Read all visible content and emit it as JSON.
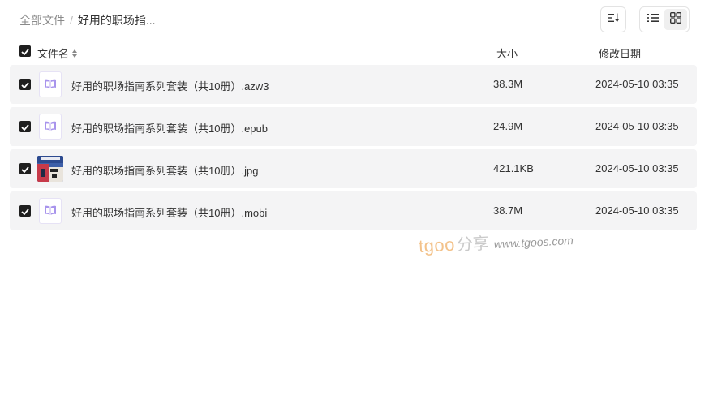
{
  "breadcrumb": {
    "root": "全部文件",
    "separator": "/",
    "current": "好用的职场指..."
  },
  "toolbar": {
    "sort_icon": "sort-icon",
    "list_view_icon": "list-view-icon",
    "grid_view_icon": "grid-view-icon",
    "active_view": "grid"
  },
  "table": {
    "columns": {
      "name": "文件名",
      "size": "大小",
      "date": "修改日期"
    },
    "select_all_checked": true,
    "rows": [
      {
        "name": "好用的职场指南系列套装（共10册）.azw3",
        "size": "38.3M",
        "date": "2024-05-10 03:35",
        "type": "ebook",
        "checked": true
      },
      {
        "name": "好用的职场指南系列套装（共10册）.epub",
        "size": "24.9M",
        "date": "2024-05-10 03:35",
        "type": "ebook",
        "checked": true
      },
      {
        "name": "好用的职场指南系列套装（共10册）.jpg",
        "size": "421.1KB",
        "date": "2024-05-10 03:35",
        "type": "image",
        "checked": true
      },
      {
        "name": "好用的职场指南系列套装（共10册）.mobi",
        "size": "38.7M",
        "date": "2024-05-10 03:35",
        "type": "ebook",
        "checked": true
      }
    ]
  },
  "watermark": {
    "brand": "tgoo",
    "share": "分享",
    "url": "www.tgoos.com"
  },
  "colors": {
    "accent_ebook": "#8b6fe0",
    "row_bg": "#f4f4f5",
    "checkbox": "#1f1f1f",
    "watermark_brand": "#f3c28a"
  }
}
